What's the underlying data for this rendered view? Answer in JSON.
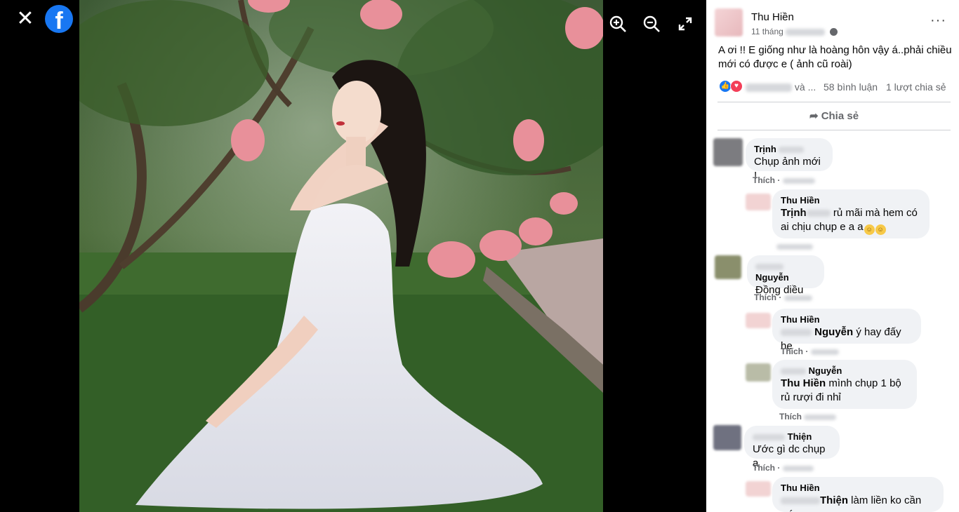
{
  "viewer": {
    "close_icon": "close-icon",
    "logo_text": "f",
    "zoom_in_icon": "zoom-in-icon",
    "zoom_out_icon": "zoom-out-icon",
    "fullscreen_icon": "fullscreen-icon"
  },
  "post": {
    "author": "Thu Hiền",
    "time_prefix": "11 tháng",
    "text": "A ơi !! E giống như là hoàng hôn vậy á..phải chiều mới có được e ( ảnh cũ roài)",
    "reactions_names_suffix": "và ...",
    "comments_count": "58 bình luận",
    "shares_count": "1 lượt chia sẻ",
    "share_label": "Chia sẻ",
    "colors": {
      "like": "#1877f2",
      "love": "#f33e58"
    }
  },
  "comments": [
    {
      "name": "Trịnh",
      "text": "Chụp ảnh mới !",
      "action": "Thích ·"
    },
    {
      "name": "Thu Hiền",
      "mention": "Trịnh",
      "text": "rủ mãi mà hem có ai chịu chụp e a a",
      "emoji": "😁😁"
    },
    {
      "name": "Nguyễn",
      "text": "Đồng diều",
      "action": "Thích ·"
    },
    {
      "name": "Thu Hiền",
      "mention": "Nguyễn",
      "text": "ý hay đấy he",
      "action": "Thích ·"
    },
    {
      "name": "Nguyễn",
      "mention": "Thu Hiền",
      "text": "mình chụp 1 bộ rủ rượi đi nhỉ",
      "action": "Thích"
    },
    {
      "name": "Thiện",
      "text": "Ước gì dc chụp ạ",
      "action": "Thích ·"
    },
    {
      "name": "Thu Hiền",
      "mention": "Thiện",
      "text": "làm liền ko cần ước"
    }
  ]
}
